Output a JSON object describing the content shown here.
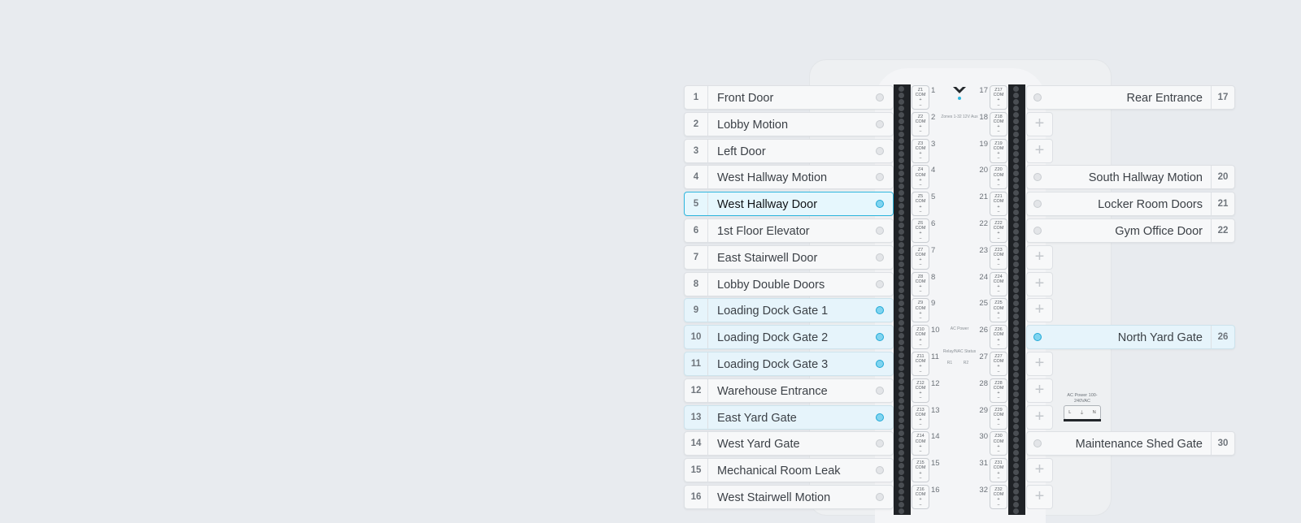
{
  "panel": {
    "center_zones_label": "Zones 1-32 12V Aux",
    "ac_power_label": "AC Power",
    "relay_label": "Relay/NAC Status",
    "relay_r1": "R1",
    "relay_r2": "R2",
    "ac_input_label": "AC Power 100-240VAC",
    "plug_l": "L",
    "plug_g": "⏚",
    "plug_n": "N",
    "terminal_com": "COM",
    "terminal_plus": "+",
    "terminal_minus": "−"
  },
  "colors": {
    "accent": "#1ea8d6",
    "active_bg": "#e6f4fb",
    "terminal_dark": "#1f2226"
  },
  "left_zones": [
    {
      "num": "1",
      "label": "Front Door",
      "state": "idle"
    },
    {
      "num": "2",
      "label": "Lobby Motion",
      "state": "idle"
    },
    {
      "num": "3",
      "label": "Left Door",
      "state": "idle"
    },
    {
      "num": "4",
      "label": "West Hallway Motion",
      "state": "idle"
    },
    {
      "num": "5",
      "label": "West Hallway Door",
      "state": "selected"
    },
    {
      "num": "6",
      "label": "1st Floor Elevator",
      "state": "idle"
    },
    {
      "num": "7",
      "label": "East Stairwell Door",
      "state": "idle"
    },
    {
      "num": "8",
      "label": "Lobby Double Doors",
      "state": "idle"
    },
    {
      "num": "9",
      "label": "Loading Dock Gate 1",
      "state": "active"
    },
    {
      "num": "10",
      "label": "Loading Dock Gate 2",
      "state": "active"
    },
    {
      "num": "11",
      "label": "Loading Dock Gate 3",
      "state": "active"
    },
    {
      "num": "12",
      "label": "Warehouse Entrance",
      "state": "idle"
    },
    {
      "num": "13",
      "label": "East Yard Gate",
      "state": "active"
    },
    {
      "num": "14",
      "label": "West Yard Gate",
      "state": "idle"
    },
    {
      "num": "15",
      "label": "Mechanical Room Leak",
      "state": "idle"
    },
    {
      "num": "16",
      "label": "West Stairwell Motion",
      "state": "idle"
    }
  ],
  "right_zones": [
    {
      "num": "17",
      "label": "Rear Entrance",
      "state": "idle"
    },
    {
      "num": "18",
      "label": "",
      "state": "empty"
    },
    {
      "num": "19",
      "label": "",
      "state": "empty"
    },
    {
      "num": "20",
      "label": "South Hallway Motion",
      "state": "idle"
    },
    {
      "num": "21",
      "label": "Locker Room Doors",
      "state": "idle"
    },
    {
      "num": "22",
      "label": "Gym Office Door",
      "state": "idle"
    },
    {
      "num": "23",
      "label": "",
      "state": "empty"
    },
    {
      "num": "24",
      "label": "",
      "state": "empty"
    },
    {
      "num": "25",
      "label": "",
      "state": "empty"
    },
    {
      "num": "26",
      "label": "North Yard Gate",
      "state": "active"
    },
    {
      "num": "27",
      "label": "",
      "state": "empty"
    },
    {
      "num": "28",
      "label": "",
      "state": "empty"
    },
    {
      "num": "29",
      "label": "",
      "state": "empty"
    },
    {
      "num": "30",
      "label": "Maintenance Shed Gate",
      "state": "idle"
    },
    {
      "num": "31",
      "label": "",
      "state": "empty"
    },
    {
      "num": "32",
      "label": "",
      "state": "empty"
    }
  ],
  "add_zone_symbol": "+"
}
